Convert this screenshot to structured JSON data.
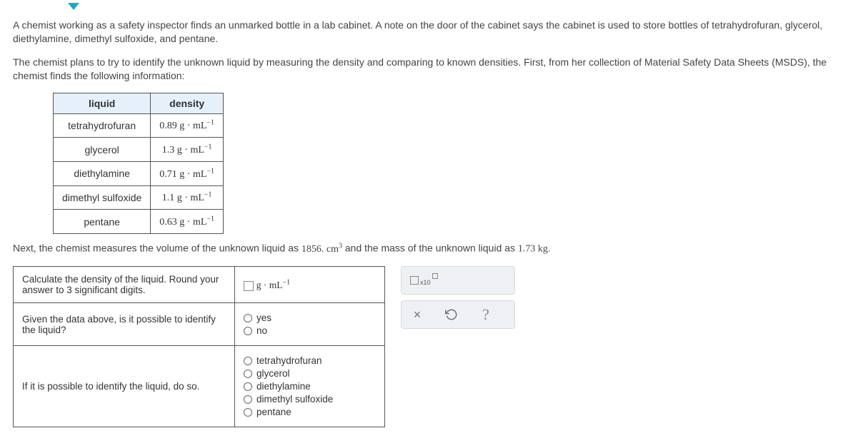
{
  "problem": {
    "para1": "A chemist working as a safety inspector finds an unmarked bottle in a lab cabinet. A note on the door of the cabinet says the cabinet is used to store bottles of tetrahydrofuran, glycerol, diethylamine, dimethyl sulfoxide, and pentane.",
    "para2": "The chemist plans to try to identify the unknown liquid by measuring the density and comparing to known densities. First, from her collection of Material Safety Data Sheets (MSDS), the chemist finds the following information:"
  },
  "density_table": {
    "headers": {
      "col1": "liquid",
      "col2": "density"
    },
    "rows": [
      {
        "liquid": "tetrahydrofuran",
        "value": "0.89",
        "unit_base": "g · mL",
        "unit_exp": "−1"
      },
      {
        "liquid": "glycerol",
        "value": "1.3",
        "unit_base": "g · mL",
        "unit_exp": "−1"
      },
      {
        "liquid": "diethylamine",
        "value": "0.71",
        "unit_base": "g · mL",
        "unit_exp": "−1"
      },
      {
        "liquid": "dimethyl sulfoxide",
        "value": "1.1",
        "unit_base": "g · mL",
        "unit_exp": "−1"
      },
      {
        "liquid": "pentane",
        "value": "0.63",
        "unit_base": "g · mL",
        "unit_exp": "−1"
      }
    ]
  },
  "measurement": {
    "prefix": "Next, the chemist measures the volume of the unknown liquid as ",
    "volume": "1856.",
    "vol_unit_base": "cm",
    "vol_unit_exp": "3",
    "mid": " and the mass of the unknown liquid as ",
    "mass": "1.73",
    "mass_unit": "kg",
    "suffix": "."
  },
  "answers": {
    "row1_prompt": "Calculate the density of the liquid. Round your answer to 3 significant digits.",
    "row1_unit_base": "g · mL",
    "row1_unit_exp": "−1",
    "row2_prompt": "Given the data above, is it possible to identify the liquid?",
    "row2_opt_yes": "yes",
    "row2_opt_no": "no",
    "row3_prompt": "If it is possible to identify the liquid, do so.",
    "row3_options": [
      "tetrahydrofuran",
      "glycerol",
      "diethylamine",
      "dimethyl sulfoxide",
      "pentane"
    ]
  },
  "toolbox": {
    "sci_x10": "x10",
    "close": "×",
    "help": "?"
  }
}
